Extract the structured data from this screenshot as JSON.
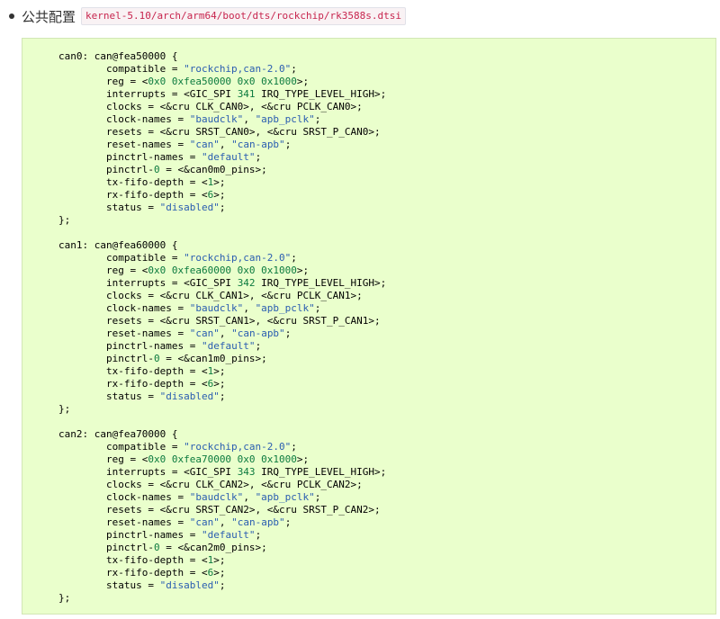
{
  "section": {
    "label": "公共配置",
    "path": "kernel-5.10/arch/arm64/boot/dts/rockchip/rk3588s.dtsi"
  },
  "code_lines": [
    [
      {
        "t": "can0: can@fea50000 {",
        "c": "p"
      }
    ],
    [
      {
        "t": "        compatible = ",
        "c": "p"
      },
      {
        "t": "\"rockchip,can-2.0\"",
        "c": "s"
      },
      {
        "t": ";",
        "c": "p"
      }
    ],
    [
      {
        "t": "        reg = <",
        "c": "p"
      },
      {
        "t": "0x0 0xfea50000 0x0 0x1000",
        "c": "n"
      },
      {
        "t": ">;",
        "c": "p"
      }
    ],
    [
      {
        "t": "        interrupts = <GIC_SPI ",
        "c": "p"
      },
      {
        "t": "341",
        "c": "n"
      },
      {
        "t": " IRQ_TYPE_LEVEL_HIGH>;",
        "c": "p"
      }
    ],
    [
      {
        "t": "        clocks = <&cru CLK_CAN0>, <&cru PCLK_CAN0>;",
        "c": "p"
      }
    ],
    [
      {
        "t": "        clock-names = ",
        "c": "p"
      },
      {
        "t": "\"baudclk\"",
        "c": "s"
      },
      {
        "t": ", ",
        "c": "p"
      },
      {
        "t": "\"apb_pclk\"",
        "c": "s"
      },
      {
        "t": ";",
        "c": "p"
      }
    ],
    [
      {
        "t": "        resets = <&cru SRST_CAN0>, <&cru SRST_P_CAN0>;",
        "c": "p"
      }
    ],
    [
      {
        "t": "        reset-names = ",
        "c": "p"
      },
      {
        "t": "\"can\"",
        "c": "s"
      },
      {
        "t": ", ",
        "c": "p"
      },
      {
        "t": "\"can-apb\"",
        "c": "s"
      },
      {
        "t": ";",
        "c": "p"
      }
    ],
    [
      {
        "t": "        pinctrl-names = ",
        "c": "p"
      },
      {
        "t": "\"default\"",
        "c": "s"
      },
      {
        "t": ";",
        "c": "p"
      }
    ],
    [
      {
        "t": "        pinctrl-",
        "c": "p"
      },
      {
        "t": "0",
        "c": "n"
      },
      {
        "t": " = <&can0m0_pins>;",
        "c": "p"
      }
    ],
    [
      {
        "t": "        tx-fifo-depth = <",
        "c": "p"
      },
      {
        "t": "1",
        "c": "n"
      },
      {
        "t": ">;",
        "c": "p"
      }
    ],
    [
      {
        "t": "        rx-fifo-depth = <",
        "c": "p"
      },
      {
        "t": "6",
        "c": "n"
      },
      {
        "t": ">;",
        "c": "p"
      }
    ],
    [
      {
        "t": "        status = ",
        "c": "p"
      },
      {
        "t": "\"disabled\"",
        "c": "s"
      },
      {
        "t": ";",
        "c": "p"
      }
    ],
    [
      {
        "t": "};",
        "c": "p"
      }
    ],
    [],
    [
      {
        "t": "can1: can@fea60000 {",
        "c": "p"
      }
    ],
    [
      {
        "t": "        compatible = ",
        "c": "p"
      },
      {
        "t": "\"rockchip,can-2.0\"",
        "c": "s"
      },
      {
        "t": ";",
        "c": "p"
      }
    ],
    [
      {
        "t": "        reg = <",
        "c": "p"
      },
      {
        "t": "0x0 0xfea60000 0x0 0x1000",
        "c": "n"
      },
      {
        "t": ">;",
        "c": "p"
      }
    ],
    [
      {
        "t": "        interrupts = <GIC_SPI ",
        "c": "p"
      },
      {
        "t": "342",
        "c": "n"
      },
      {
        "t": " IRQ_TYPE_LEVEL_HIGH>;",
        "c": "p"
      }
    ],
    [
      {
        "t": "        clocks = <&cru CLK_CAN1>, <&cru PCLK_CAN1>;",
        "c": "p"
      }
    ],
    [
      {
        "t": "        clock-names = ",
        "c": "p"
      },
      {
        "t": "\"baudclk\"",
        "c": "s"
      },
      {
        "t": ", ",
        "c": "p"
      },
      {
        "t": "\"apb_pclk\"",
        "c": "s"
      },
      {
        "t": ";",
        "c": "p"
      }
    ],
    [
      {
        "t": "        resets = <&cru SRST_CAN1>, <&cru SRST_P_CAN1>;",
        "c": "p"
      }
    ],
    [
      {
        "t": "        reset-names = ",
        "c": "p"
      },
      {
        "t": "\"can\"",
        "c": "s"
      },
      {
        "t": ", ",
        "c": "p"
      },
      {
        "t": "\"can-apb\"",
        "c": "s"
      },
      {
        "t": ";",
        "c": "p"
      }
    ],
    [
      {
        "t": "        pinctrl-names = ",
        "c": "p"
      },
      {
        "t": "\"default\"",
        "c": "s"
      },
      {
        "t": ";",
        "c": "p"
      }
    ],
    [
      {
        "t": "        pinctrl-",
        "c": "p"
      },
      {
        "t": "0",
        "c": "n"
      },
      {
        "t": " = <&can1m0_pins>;",
        "c": "p"
      }
    ],
    [
      {
        "t": "        tx-fifo-depth = <",
        "c": "p"
      },
      {
        "t": "1",
        "c": "n"
      },
      {
        "t": ">;",
        "c": "p"
      }
    ],
    [
      {
        "t": "        rx-fifo-depth = <",
        "c": "p"
      },
      {
        "t": "6",
        "c": "n"
      },
      {
        "t": ">;",
        "c": "p"
      }
    ],
    [
      {
        "t": "        status = ",
        "c": "p"
      },
      {
        "t": "\"disabled\"",
        "c": "s"
      },
      {
        "t": ";",
        "c": "p"
      }
    ],
    [
      {
        "t": "};",
        "c": "p"
      }
    ],
    [],
    [
      {
        "t": "can2: can@fea70000 {",
        "c": "p"
      }
    ],
    [
      {
        "t": "        compatible = ",
        "c": "p"
      },
      {
        "t": "\"rockchip,can-2.0\"",
        "c": "s"
      },
      {
        "t": ";",
        "c": "p"
      }
    ],
    [
      {
        "t": "        reg = <",
        "c": "p"
      },
      {
        "t": "0x0 0xfea70000 0x0 0x1000",
        "c": "n"
      },
      {
        "t": ">;",
        "c": "p"
      }
    ],
    [
      {
        "t": "        interrupts = <GIC_SPI ",
        "c": "p"
      },
      {
        "t": "343",
        "c": "n"
      },
      {
        "t": " IRQ_TYPE_LEVEL_HIGH>;",
        "c": "p"
      }
    ],
    [
      {
        "t": "        clocks = <&cru CLK_CAN2>, <&cru PCLK_CAN2>;",
        "c": "p"
      }
    ],
    [
      {
        "t": "        clock-names = ",
        "c": "p"
      },
      {
        "t": "\"baudclk\"",
        "c": "s"
      },
      {
        "t": ", ",
        "c": "p"
      },
      {
        "t": "\"apb_pclk\"",
        "c": "s"
      },
      {
        "t": ";",
        "c": "p"
      }
    ],
    [
      {
        "t": "        resets = <&cru SRST_CAN2>, <&cru SRST_P_CAN2>;",
        "c": "p"
      }
    ],
    [
      {
        "t": "        reset-names = ",
        "c": "p"
      },
      {
        "t": "\"can\"",
        "c": "s"
      },
      {
        "t": ", ",
        "c": "p"
      },
      {
        "t": "\"can-apb\"",
        "c": "s"
      },
      {
        "t": ";",
        "c": "p"
      }
    ],
    [
      {
        "t": "        pinctrl-names = ",
        "c": "p"
      },
      {
        "t": "\"default\"",
        "c": "s"
      },
      {
        "t": ";",
        "c": "p"
      }
    ],
    [
      {
        "t": "        pinctrl-",
        "c": "p"
      },
      {
        "t": "0",
        "c": "n"
      },
      {
        "t": " = <&can2m0_pins>;",
        "c": "p"
      }
    ],
    [
      {
        "t": "        tx-fifo-depth = <",
        "c": "p"
      },
      {
        "t": "1",
        "c": "n"
      },
      {
        "t": ">;",
        "c": "p"
      }
    ],
    [
      {
        "t": "        rx-fifo-depth = <",
        "c": "p"
      },
      {
        "t": "6",
        "c": "n"
      },
      {
        "t": ">;",
        "c": "p"
      }
    ],
    [
      {
        "t": "        status = ",
        "c": "p"
      },
      {
        "t": "\"disabled\"",
        "c": "s"
      },
      {
        "t": ";",
        "c": "p"
      }
    ],
    [
      {
        "t": "};",
        "c": "p"
      }
    ]
  ],
  "colors": {
    "string": "#2a5db0",
    "number": "#0b7a3e",
    "code_background": "#eaffcc",
    "path_text": "#c7254e"
  }
}
